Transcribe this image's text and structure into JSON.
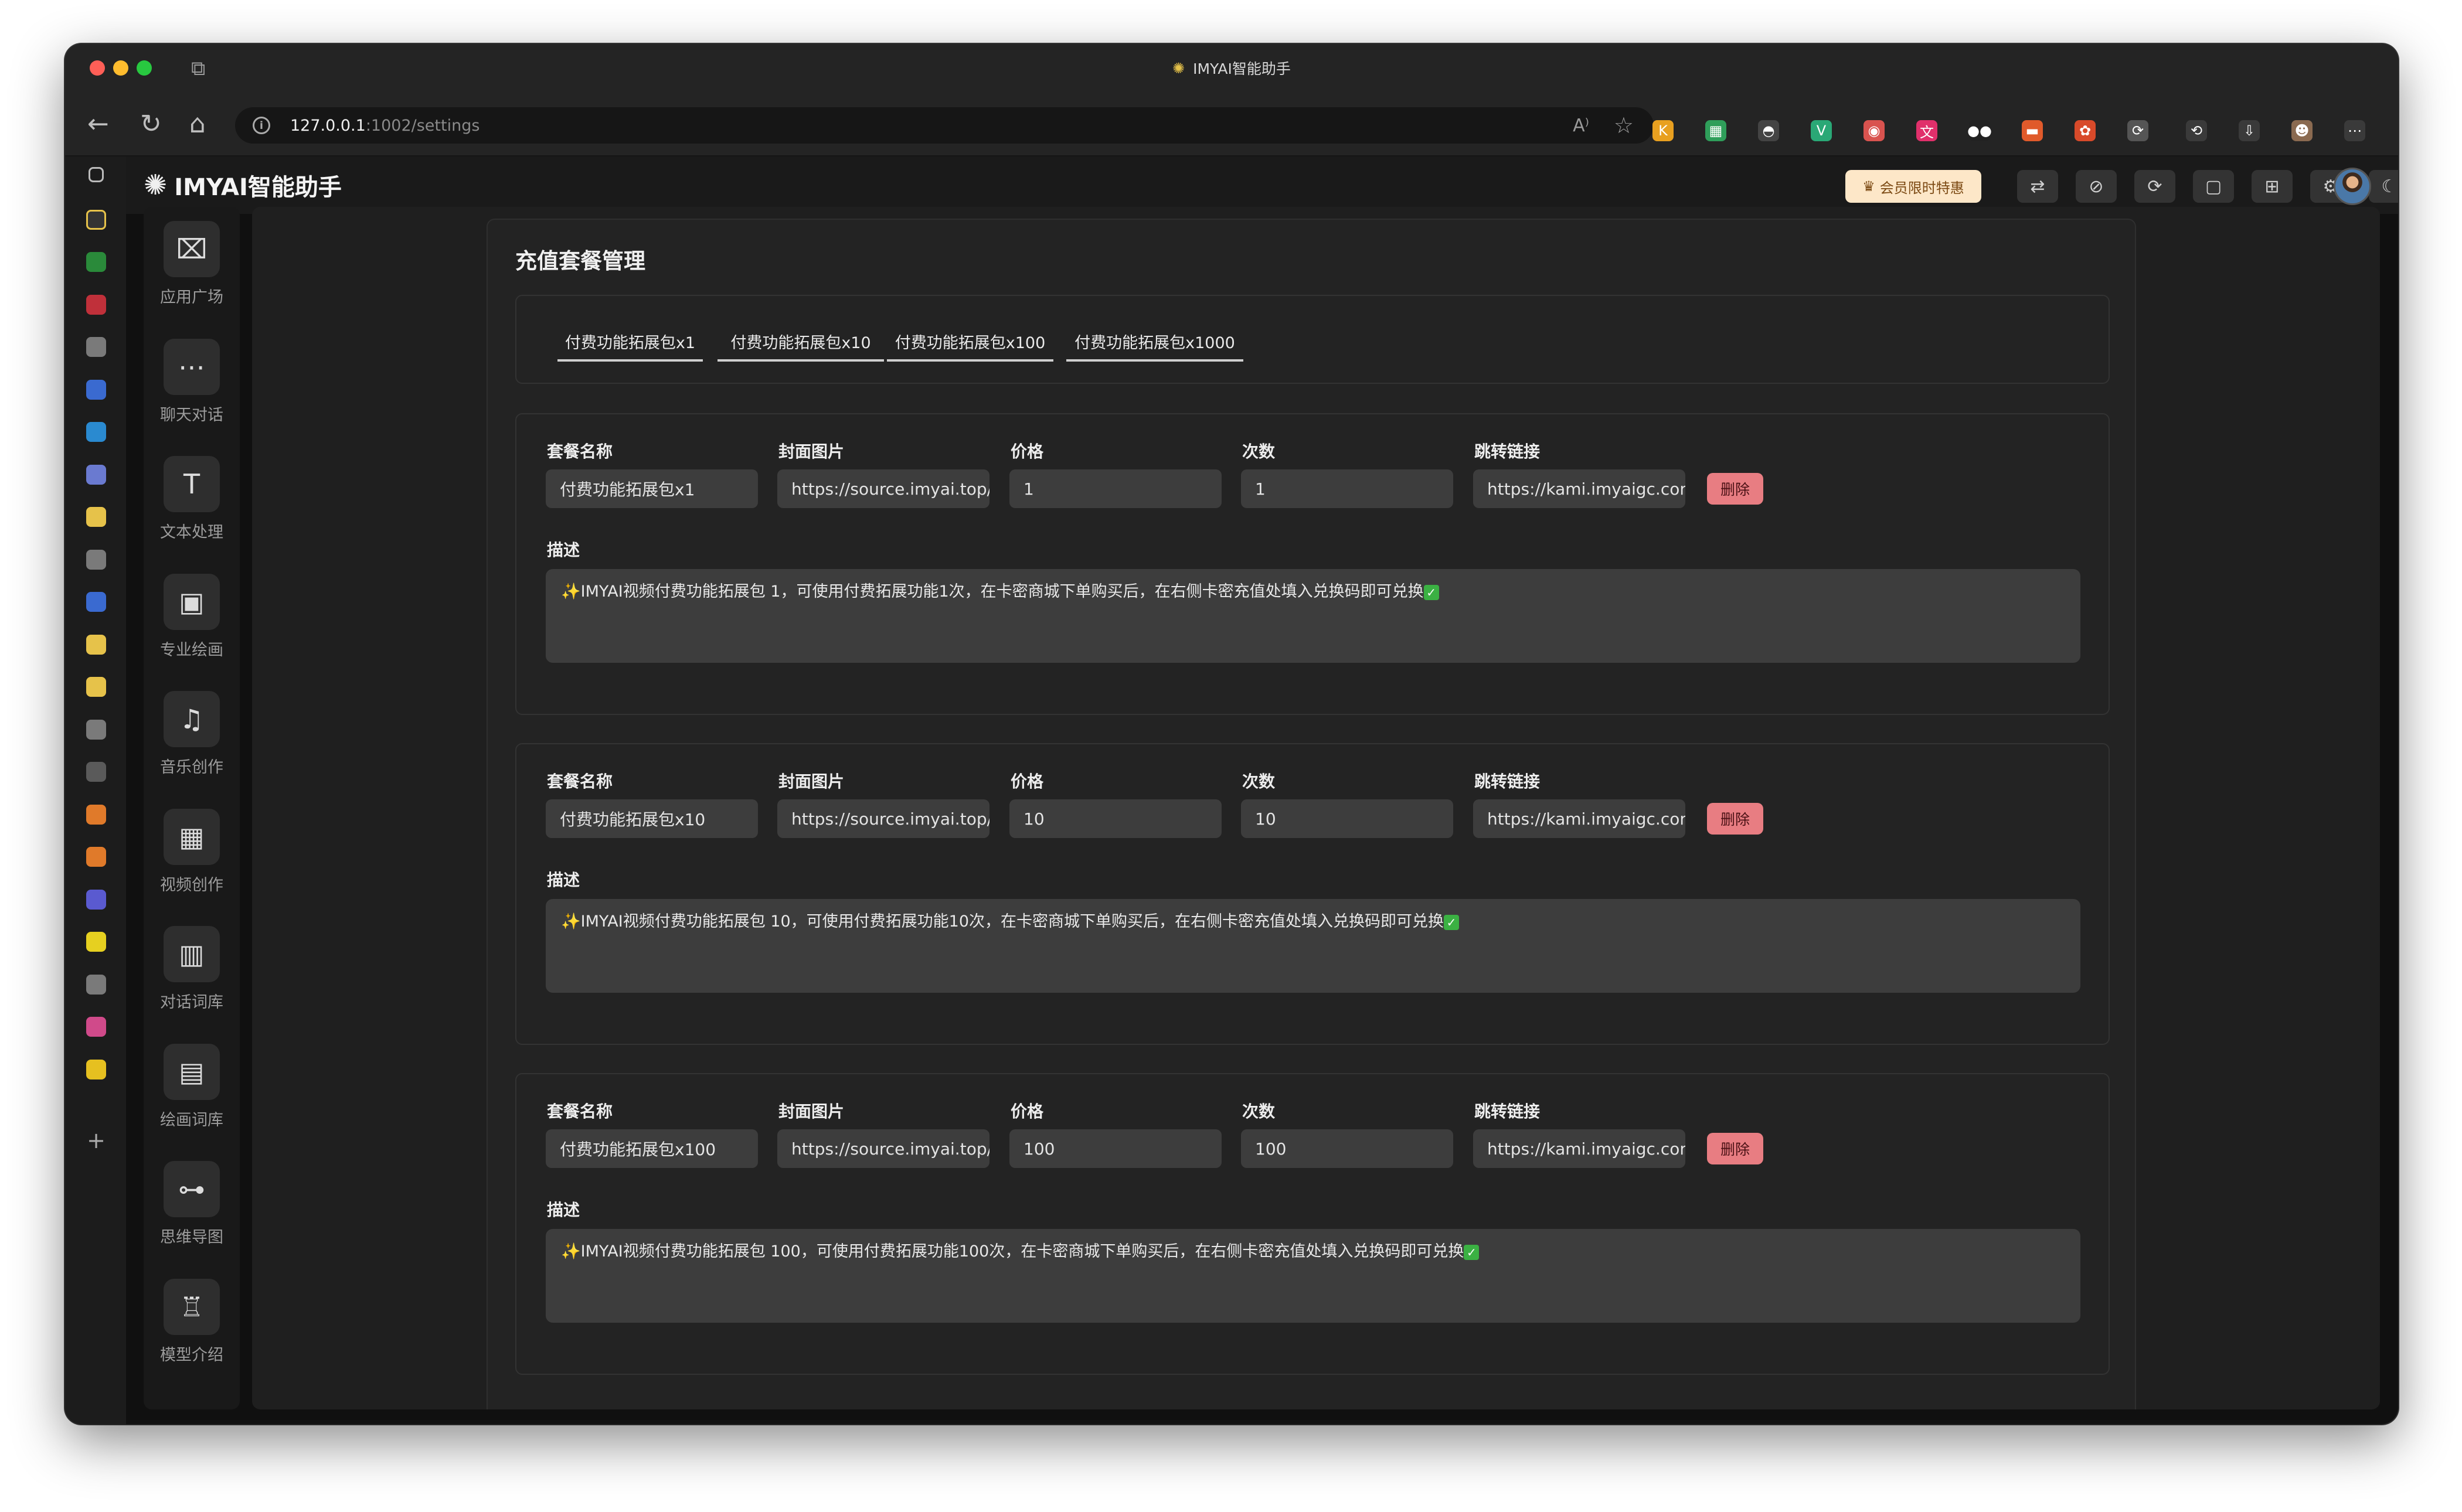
{
  "browser": {
    "window_title": "IMYAI智能助手",
    "url_host": "127.0.0.1",
    "url_path": ":1002/settings",
    "read_aloud_icon": "A⁾",
    "extensions": [
      {
        "name": "extension-k-icon",
        "glyph": "K",
        "color": "#e8a020"
      },
      {
        "name": "extension-table-icon",
        "glyph": "▦",
        "color": "#2f9e5a"
      },
      {
        "name": "extension-mask-icon",
        "glyph": "◓",
        "color": "#444444"
      },
      {
        "name": "extension-vue-icon",
        "glyph": "V",
        "color": "#2aa876"
      },
      {
        "name": "extension-chrome-icon",
        "glyph": "◉",
        "color": "#d9534f"
      },
      {
        "name": "extension-translate-icon",
        "glyph": "文",
        "color": "#e0306b"
      },
      {
        "name": "extension-medium-icon",
        "glyph": "●●",
        "color": "#222222"
      },
      {
        "name": "extension-toolbox-icon",
        "glyph": "▬",
        "color": "#e05a2b"
      },
      {
        "name": "extension-flower-icon",
        "glyph": "✿",
        "color": "#d84a2a"
      },
      {
        "name": "extension-puzzle-icon",
        "glyph": "⟳",
        "color": "#555555"
      },
      {
        "name": "history-icon",
        "glyph": "⟲",
        "color": "#3a3a3a"
      },
      {
        "name": "download-icon",
        "glyph": "⇩",
        "color": "#3a3a3a"
      },
      {
        "name": "profile-icon",
        "glyph": "☻",
        "color": "#8a6a50"
      },
      {
        "name": "more-icon",
        "glyph": "⋯",
        "color": "#3a3a3a"
      }
    ]
  },
  "app": {
    "logo_text": "IMYAI智能助手",
    "vip_button": "会员限时特惠",
    "header_icons": [
      "translate-icon",
      "link-icon",
      "sync-icon",
      "clipboard-icon",
      "gift-icon",
      "settings-icon",
      "dark-mode-icon"
    ]
  },
  "sidebar": {
    "items": [
      {
        "label": "应用广场",
        "icon": "app-square-icon",
        "glyph": "⌧"
      },
      {
        "label": "聊天对话",
        "icon": "chat-icon",
        "glyph": "⋯"
      },
      {
        "label": "文本处理",
        "icon": "text-icon",
        "glyph": "T"
      },
      {
        "label": "专业绘画",
        "icon": "image-icon",
        "glyph": "▣"
      },
      {
        "label": "音乐创作",
        "icon": "music-icon",
        "glyph": "♫"
      },
      {
        "label": "视频创作",
        "icon": "video-icon",
        "glyph": "▦"
      },
      {
        "label": "对话词库",
        "icon": "library-icon",
        "glyph": "▥"
      },
      {
        "label": "绘画词库",
        "icon": "draw-library-icon",
        "glyph": "▤"
      },
      {
        "label": "思维导图",
        "icon": "mindmap-icon",
        "glyph": "⊶"
      },
      {
        "label": "模型介绍",
        "icon": "robot-icon",
        "glyph": "♖"
      }
    ]
  },
  "panel": {
    "title": "充值套餐管理",
    "tabs": [
      "付费功能拓展包x1",
      "付费功能拓展包x10",
      "付费功能拓展包x100",
      "付费功能拓展包x1000"
    ],
    "labels": {
      "name": "套餐名称",
      "cover": "封面图片",
      "price": "价格",
      "count": "次数",
      "link": "跳转链接",
      "desc": "描述",
      "delete": "删除"
    },
    "packages": [
      {
        "name": "付费功能拓展包x1",
        "cover": "https://source.imyai.top/i",
        "price": "1",
        "count": "1",
        "link": "https://kami.imyaigc.com",
        "desc": "✨IMYAI视频付费功能拓展包   1，可使用付费拓展功能1次，在卡密商城下单购买后，在右侧卡密充值处填入兑换码即可兑换"
      },
      {
        "name": "付费功能拓展包x10",
        "cover": "https://source.imyai.top/i",
        "price": "10",
        "count": "10",
        "link": "https://kami.imyaigc.com",
        "desc": "✨IMYAI视频付费功能拓展包   10，可使用付费拓展功能10次，在卡密商城下单购买后，在右侧卡密充值处填入兑换码即可兑换"
      },
      {
        "name": "付费功能拓展包x100",
        "cover": "https://source.imyai.top/i",
        "price": "100",
        "count": "100",
        "link": "https://kami.imyaigc.com",
        "desc": "✨IMYAI视频付费功能拓展包   100，可使用付费拓展功能100次，在卡密商城下单购买后，在右侧卡密充值处填入兑换码即可兑换"
      }
    ]
  }
}
